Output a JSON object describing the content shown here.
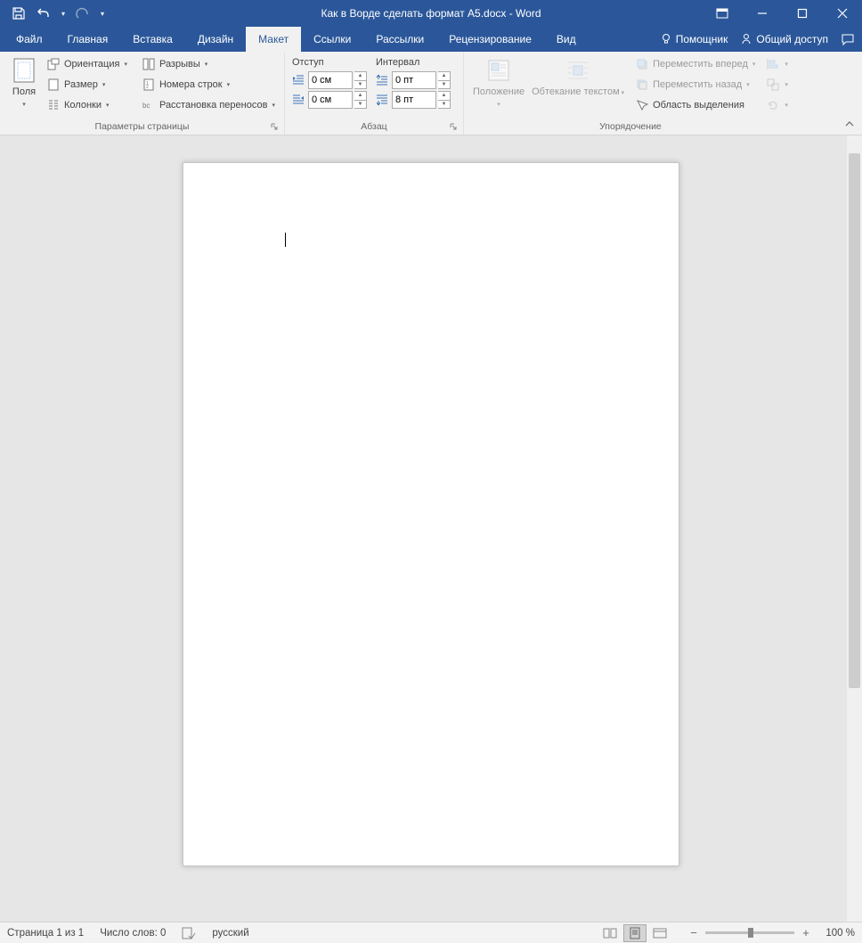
{
  "title": "Как в Ворде сделать формат A5.docx - Word",
  "tabs": {
    "file": "Файл",
    "home": "Главная",
    "insert": "Вставка",
    "design": "Дизайн",
    "layout": "Макет",
    "references": "Ссылки",
    "mailings": "Рассылки",
    "review": "Рецензирование",
    "view": "Вид",
    "help": "Помощник",
    "share": "Общий доступ"
  },
  "ribbon": {
    "page_setup": {
      "label": "Параметры страницы",
      "margins": "Поля",
      "orientation": "Ориентация",
      "size": "Размер",
      "columns": "Колонки",
      "breaks": "Разрывы",
      "line_numbers": "Номера строк",
      "hyphenation": "Расстановка переносов"
    },
    "paragraph": {
      "label": "Абзац",
      "indent": "Отступ",
      "spacing": "Интервал",
      "indent_left": "0 см",
      "indent_right": "0 см",
      "space_before": "0 пт",
      "space_after": "8 пт"
    },
    "arrange": {
      "label": "Упорядочение",
      "position": "Положение",
      "wrap": "Обтекание текстом",
      "bring_forward": "Переместить вперед",
      "send_backward": "Переместить назад",
      "selection_pane": "Область выделения"
    }
  },
  "status": {
    "page": "Страница 1 из 1",
    "words": "Число слов: 0",
    "language": "русский",
    "zoom": "100 %"
  }
}
